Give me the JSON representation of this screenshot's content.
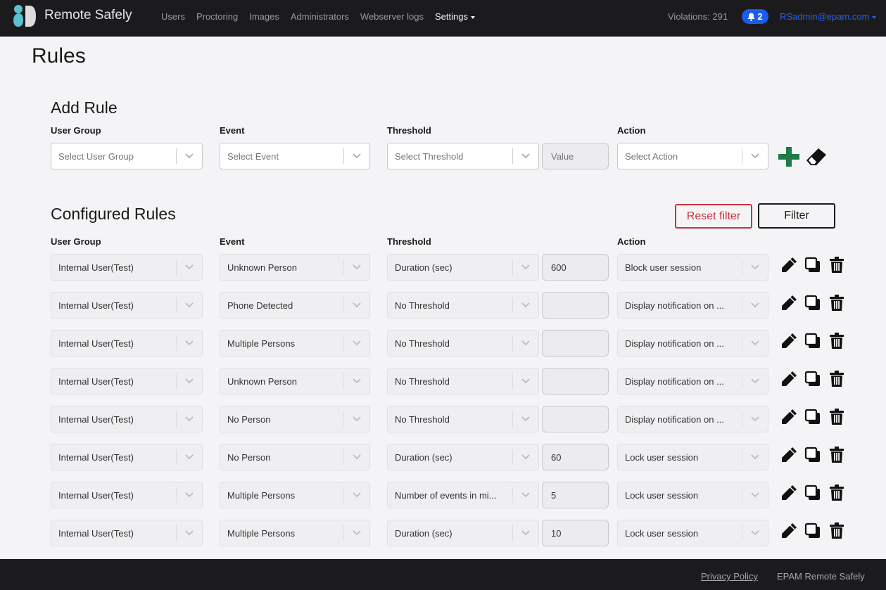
{
  "app": {
    "brand": "Remote Safely",
    "nav": [
      {
        "label": "Users"
      },
      {
        "label": "Proctoring"
      },
      {
        "label": "Images"
      },
      {
        "label": "Administrators"
      },
      {
        "label": "Webserver logs"
      },
      {
        "label": "Settings",
        "active": true,
        "dropdown": true
      }
    ],
    "violations": "Violations: 291",
    "notifications": "2",
    "user": "RSadmin@epam.com",
    "colors": {
      "accent": "#1a5cf0",
      "add": "#1e7a46",
      "danger": "#c8323f"
    }
  },
  "page": {
    "title": "Rules"
  },
  "add_rule": {
    "title": "Add Rule",
    "labels": {
      "user_group": "User Group",
      "event": "Event",
      "threshold": "Threshold",
      "action": "Action"
    },
    "user_group_placeholder": "Select User Group",
    "event_placeholder": "Select Event",
    "threshold_placeholder": "Select Threshold",
    "value_placeholder": "Value",
    "action_placeholder": "Select Action",
    "add_icon": "plus-icon",
    "clear_icon": "eraser-icon"
  },
  "configured": {
    "title": "Configured Rules",
    "reset_label": "Reset filter",
    "filter_label": "Filter",
    "labels": {
      "user_group": "User Group",
      "event": "Event",
      "threshold": "Threshold",
      "action": "Action"
    },
    "rows": [
      {
        "user_group": "Internal User(Test)",
        "event": "Unknown Person",
        "threshold": "Duration (sec)",
        "value": "600",
        "action": "Block user session"
      },
      {
        "user_group": "Internal User(Test)",
        "event": "Phone Detected",
        "threshold": "No Threshold",
        "value": "",
        "action": "Display notification on ..."
      },
      {
        "user_group": "Internal User(Test)",
        "event": "Multiple Persons",
        "threshold": "No Threshold",
        "value": "",
        "action": "Display notification on ..."
      },
      {
        "user_group": "Internal User(Test)",
        "event": "Unknown Person",
        "threshold": "No Threshold",
        "value": "",
        "action": "Display notification on ..."
      },
      {
        "user_group": "Internal User(Test)",
        "event": "No Person",
        "threshold": "No Threshold",
        "value": "",
        "action": "Display notification on ..."
      },
      {
        "user_group": "Internal User(Test)",
        "event": "No Person",
        "threshold": "Duration (sec)",
        "value": "60",
        "action": "Lock user session"
      },
      {
        "user_group": "Internal User(Test)",
        "event": "Multiple Persons",
        "threshold": "Number of events in mi...",
        "value": "5",
        "action": "Lock user session"
      },
      {
        "user_group": "Internal User(Test)",
        "event": "Multiple Persons",
        "threshold": "Duration (sec)",
        "value": "10",
        "action": "Lock user session"
      }
    ],
    "row_icons": [
      "pencil-icon",
      "copy-icon",
      "trash-icon"
    ]
  },
  "footer": {
    "privacy": "Privacy Policy",
    "brand": "EPAM Remote Safely"
  }
}
